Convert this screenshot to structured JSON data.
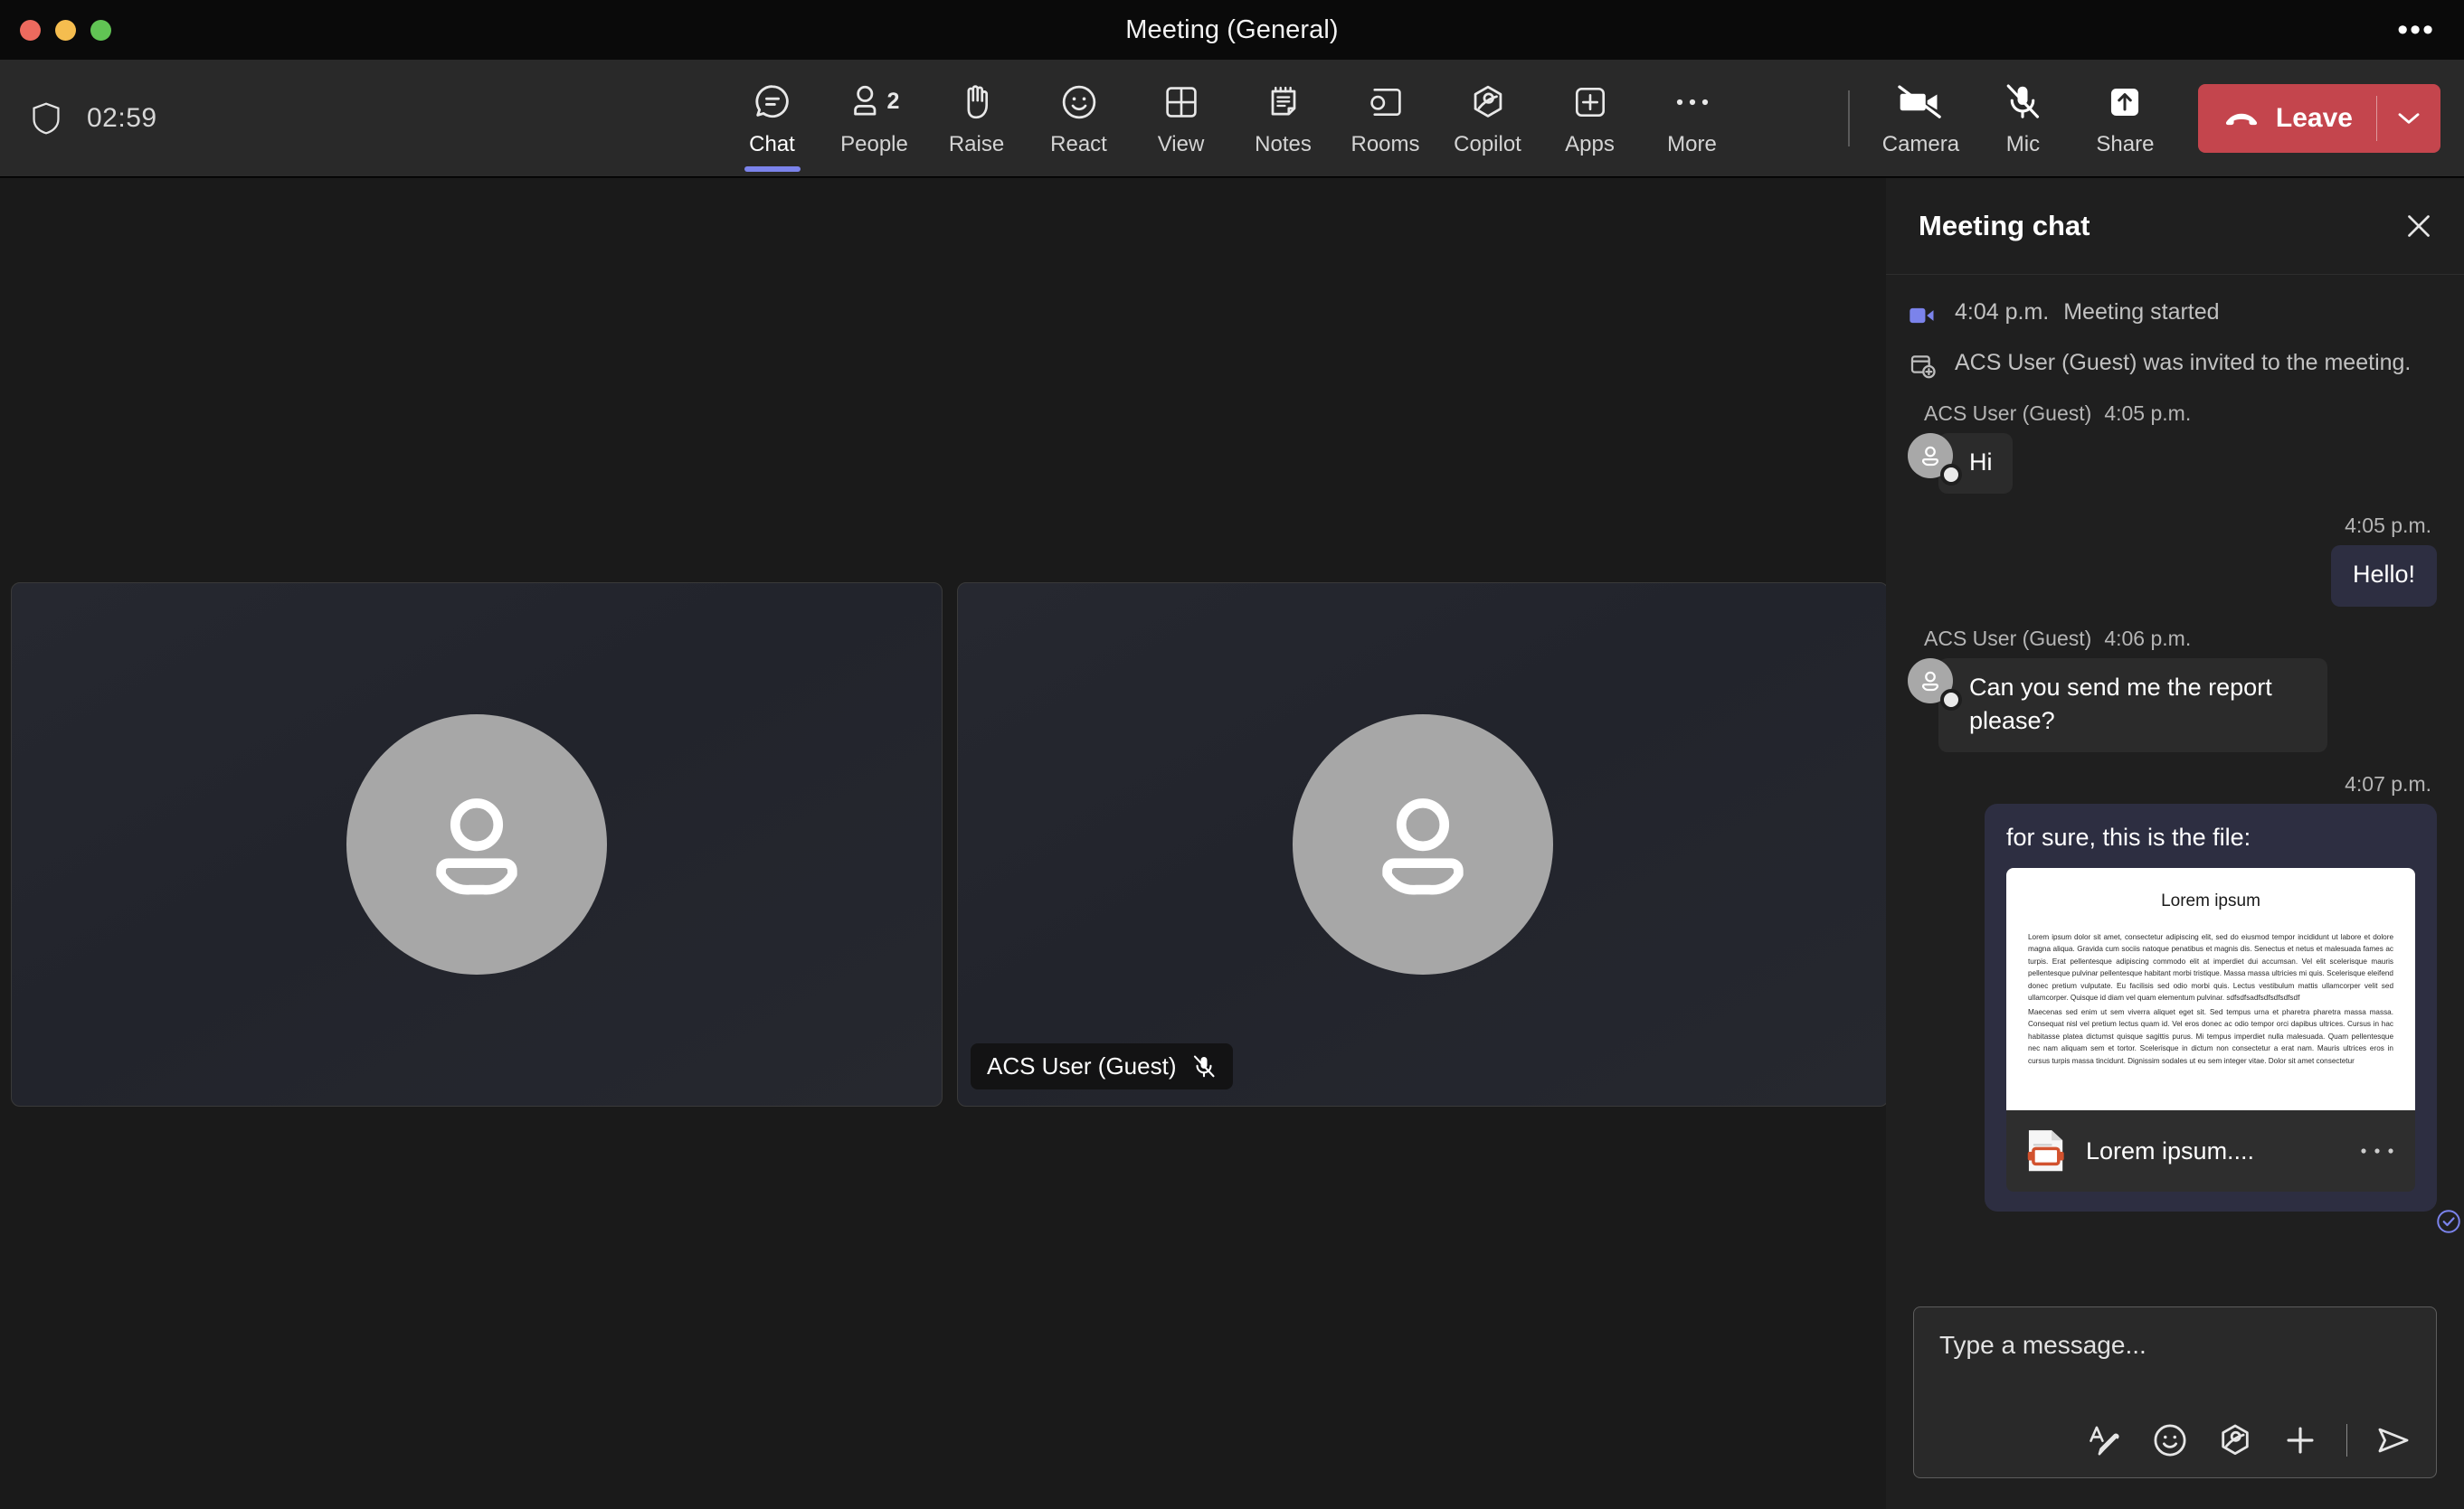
{
  "window": {
    "title": "Meeting (General)",
    "more_menu": "•••",
    "traffic": [
      "close",
      "minimize",
      "zoom"
    ]
  },
  "toolbar": {
    "timer": "02:59",
    "shield_icon": "shield-icon",
    "items": [
      {
        "label": "Chat",
        "icon": "chat-icon",
        "active": true,
        "badge": ""
      },
      {
        "label": "People",
        "icon": "people-icon",
        "active": false,
        "badge": "2"
      },
      {
        "label": "Raise",
        "icon": "raise-hand-icon",
        "active": false,
        "badge": ""
      },
      {
        "label": "React",
        "icon": "react-smiley-icon",
        "active": false,
        "badge": ""
      },
      {
        "label": "View",
        "icon": "view-grid-icon",
        "active": false,
        "badge": ""
      },
      {
        "label": "Notes",
        "icon": "notes-icon",
        "active": false,
        "badge": ""
      },
      {
        "label": "Rooms",
        "icon": "rooms-icon",
        "active": false,
        "badge": ""
      },
      {
        "label": "Copilot",
        "icon": "copilot-icon",
        "active": false,
        "badge": ""
      },
      {
        "label": "Apps",
        "icon": "apps-plus-icon",
        "active": false,
        "badge": ""
      },
      {
        "label": "More",
        "icon": "more-dots-icon",
        "active": false,
        "badge": ""
      }
    ],
    "camera": {
      "label": "Camera",
      "icon": "camera-off-icon",
      "state": "off"
    },
    "mic": {
      "label": "Mic",
      "icon": "mic-off-icon",
      "state": "off"
    },
    "share": {
      "label": "Share",
      "icon": "share-screen-icon"
    },
    "leave": {
      "label": "Leave",
      "icon": "hang-up-icon",
      "chevron": "chevron-down-icon",
      "color": "#c4454d"
    }
  },
  "stage": {
    "tiles": [
      {
        "name": "",
        "muted": false,
        "avatar_icon": "person-icon"
      },
      {
        "name": "ACS User (Guest)",
        "muted": true,
        "avatar_icon": "person-icon"
      }
    ]
  },
  "chat": {
    "title": "Meeting chat",
    "close_icon": "close-icon",
    "system": [
      {
        "icon": "video-camera-icon",
        "time": "4:04 p.m.",
        "text": "Meeting started"
      },
      {
        "icon": "add-participant-icon",
        "time": "",
        "text": "ACS User (Guest) was invited to the meeting."
      }
    ],
    "messages": [
      {
        "direction": "in",
        "author": "ACS User (Guest)",
        "time": "4:05 p.m.",
        "text": "Hi"
      },
      {
        "direction": "out",
        "author": "",
        "time": "4:05 p.m.",
        "text": "Hello!"
      },
      {
        "direction": "in",
        "author": "ACS User (Guest)",
        "time": "4:06 p.m.",
        "text": "Can you send me the report please?"
      },
      {
        "direction": "out",
        "author": "",
        "time": "4:07 p.m.",
        "text": "for sure, this is the file:",
        "attachment": {
          "file_name": "Lorem ipsum....",
          "file_icon": "powerpoint-file-icon",
          "more_icon": "more-dots-icon",
          "preview_title": "Lorem ipsum",
          "preview_paragraph_1": "Lorem ipsum dolor sit amet, consectetur adipiscing elit, sed do eiusmod tempor incididunt ut labore et dolore magna aliqua. Gravida cum sociis natoque penatibus et magnis dis. Senectus et netus et malesuada fames ac turpis. Erat pellentesque adipiscing commodo elit at imperdiet dui accumsan. Vel elit scelerisque mauris pellentesque pulvinar pellentesque habitant morbi tristique. Massa massa ultricies mi quis. Scelerisque eleifend donec pretium vulputate. Eu facilisis sed odio morbi quis. Lectus vestibulum mattis ullamcorper velit sed ullamcorper. Quisque id diam vel quam elementum pulvinar. sdfsdfsadfsdfsdfsdfsdf",
          "preview_paragraph_2": "Maecenas sed enim ut sem viverra aliquet eget sit. Sed tempus urna et pharetra pharetra massa massa. Consequat nisl vel pretium lectus quam id. Vel eros donec ac odio tempor orci dapibus ultrices. Cursus in hac habitasse platea dictumst quisque sagittis purus. Mi tempus imperdiet nulla malesuada. Quam pellentesque nec nam aliquam sem et tortor. Scelerisque in dictum non consectetur a erat nam. Mauris ultrices eros in cursus turpis massa tincidunt. Dignissim sodales ut eu sem integer vitae. Dolor sit amet consectetur"
        },
        "status_icon": "delivered-check-icon"
      }
    ],
    "composer": {
      "placeholder": "Type a message...",
      "value": "Type a message...",
      "tools": [
        {
          "icon": "format-text-icon",
          "name": "format"
        },
        {
          "icon": "emoji-icon",
          "name": "emoji"
        },
        {
          "icon": "giphy-icon",
          "name": "giphy"
        },
        {
          "icon": "attach-plus-icon",
          "name": "attach"
        },
        {
          "icon": "send-icon",
          "name": "send"
        }
      ]
    }
  },
  "colors": {
    "accent": "#7b83eb",
    "leave_red": "#c4454d",
    "panel_bg": "#1f1f1f",
    "toolbar_bg": "#292929",
    "stage_bg": "#1a1a1a",
    "out_bubble": "#2d2e41",
    "in_bubble": "#2b2b2b"
  }
}
